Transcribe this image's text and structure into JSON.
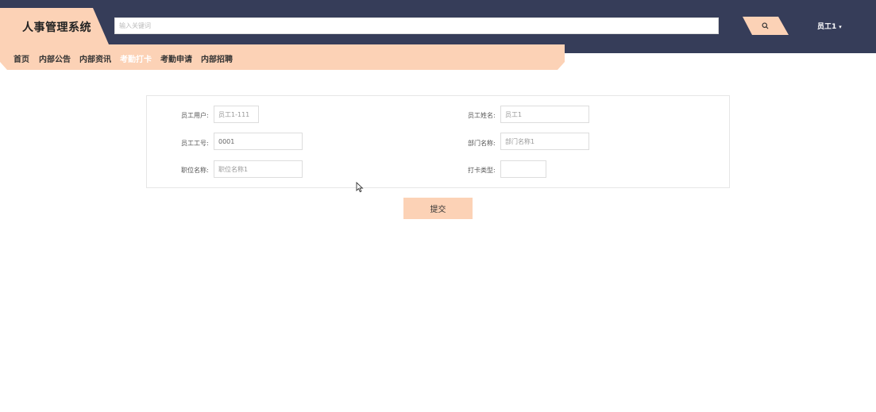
{
  "header": {
    "app_title": "人事管理系统",
    "search_placeholder": "输入关键词",
    "search_icon": "search-icon",
    "user_label": "员工1",
    "user_caret": "▾"
  },
  "nav": {
    "items": [
      {
        "label": "首页"
      },
      {
        "label": "内部公告"
      },
      {
        "label": "内部资讯"
      },
      {
        "label": "考勤打卡",
        "active": true
      },
      {
        "label": "考勤申请"
      },
      {
        "label": "内部招聘"
      }
    ]
  },
  "form": {
    "employee_user": {
      "label": "员工用户:",
      "value": "员工1-111"
    },
    "employee_name": {
      "label": "员工姓名:",
      "value": "员工1"
    },
    "employee_no": {
      "label": "员工工号:",
      "value": "0001"
    },
    "department": {
      "label": "部门名称:",
      "value": "部门名称1"
    },
    "position": {
      "label": "职位名称:",
      "value": "职位名称1"
    },
    "punch_type": {
      "label": "打卡类型:",
      "value": ""
    },
    "submit_label": "提交"
  },
  "colors": {
    "topbar": "#363d59",
    "accent": "#fcd2b6"
  }
}
